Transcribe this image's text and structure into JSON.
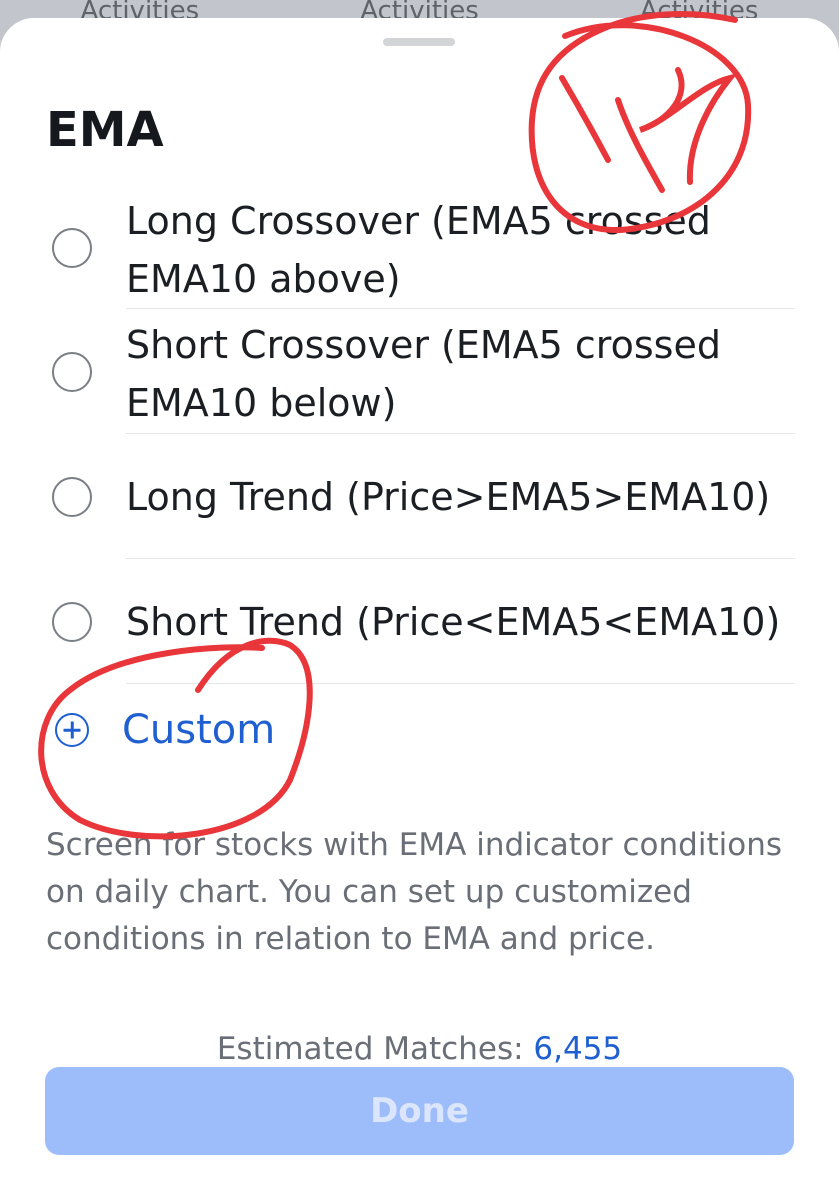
{
  "backdrop": {
    "tabs": [
      "Activities",
      "Activities",
      "Activities"
    ]
  },
  "sheet": {
    "title": "EMA",
    "options": [
      {
        "label": "Long Crossover (EMA5 crossed EMA10 above)",
        "selected": false
      },
      {
        "label": "Short Crossover (EMA5 crossed EMA10 below)",
        "selected": false
      },
      {
        "label": "Long Trend (Price>EMA5>EMA10)",
        "selected": false
      },
      {
        "label": "Short Trend (Price<EMA5<EMA10)",
        "selected": false
      }
    ],
    "custom_label": "Custom",
    "description": "Screen for stocks with EMA indicator conditions on daily chart. You can set up customized conditions in relation to EMA and price.",
    "matches_label": "Estimated Matches:",
    "matches_count": "6,455",
    "done_label": "Done"
  },
  "annotation_text": "1K",
  "colors": {
    "accent": "#1f5fcf",
    "done_button": "#9dbdfa",
    "annotation": "#e8363a"
  }
}
